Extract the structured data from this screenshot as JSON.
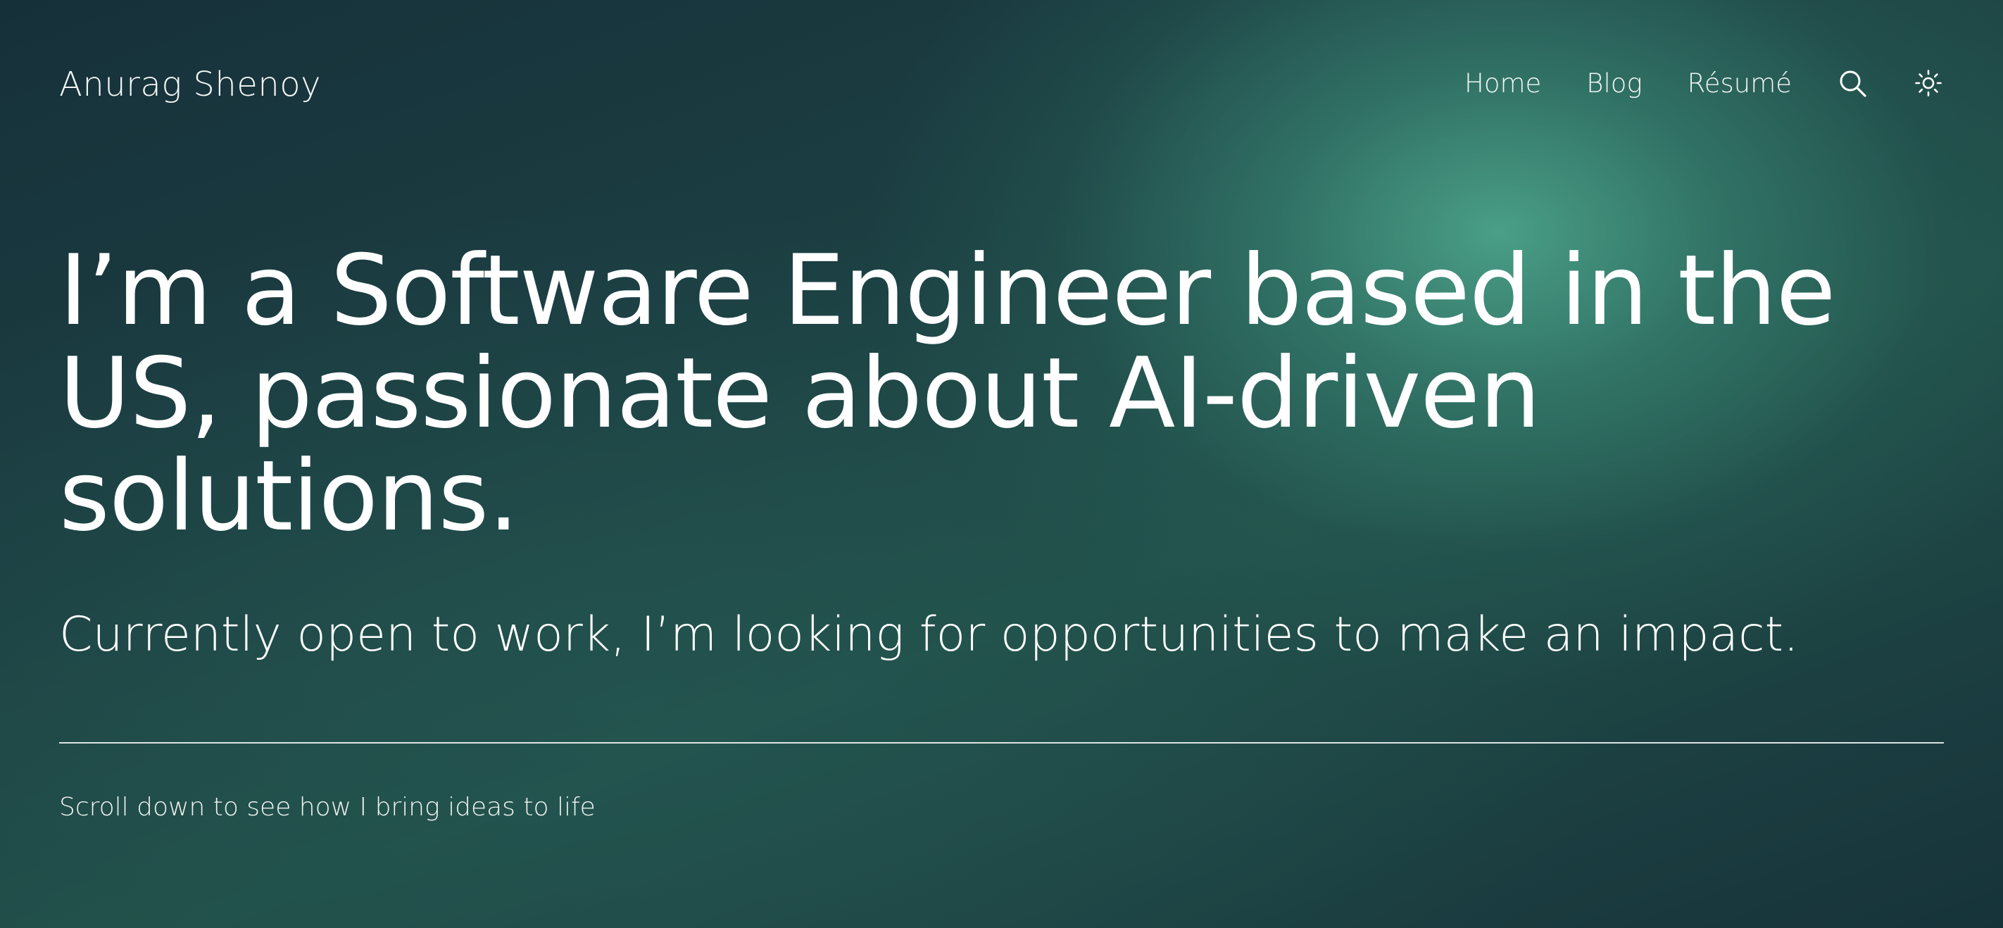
{
  "header": {
    "brand": "Anurag Shenoy",
    "nav": {
      "home": "Home",
      "blog": "Blog",
      "resume": "Résumé"
    },
    "icons": {
      "search": "search-icon",
      "theme": "sun-icon"
    }
  },
  "hero": {
    "headline": "I’m a Software Engineer based in the US, passionate about AI-driven solutions.",
    "subheadline": "Currently open to work, I’m looking for opportunities to make an impact.",
    "scroll_hint": "Scroll down to see how I bring ideas to life"
  },
  "colors": {
    "text": "#ffffff",
    "background_dark": "#16303a",
    "background_glow": "#4ca38a"
  }
}
